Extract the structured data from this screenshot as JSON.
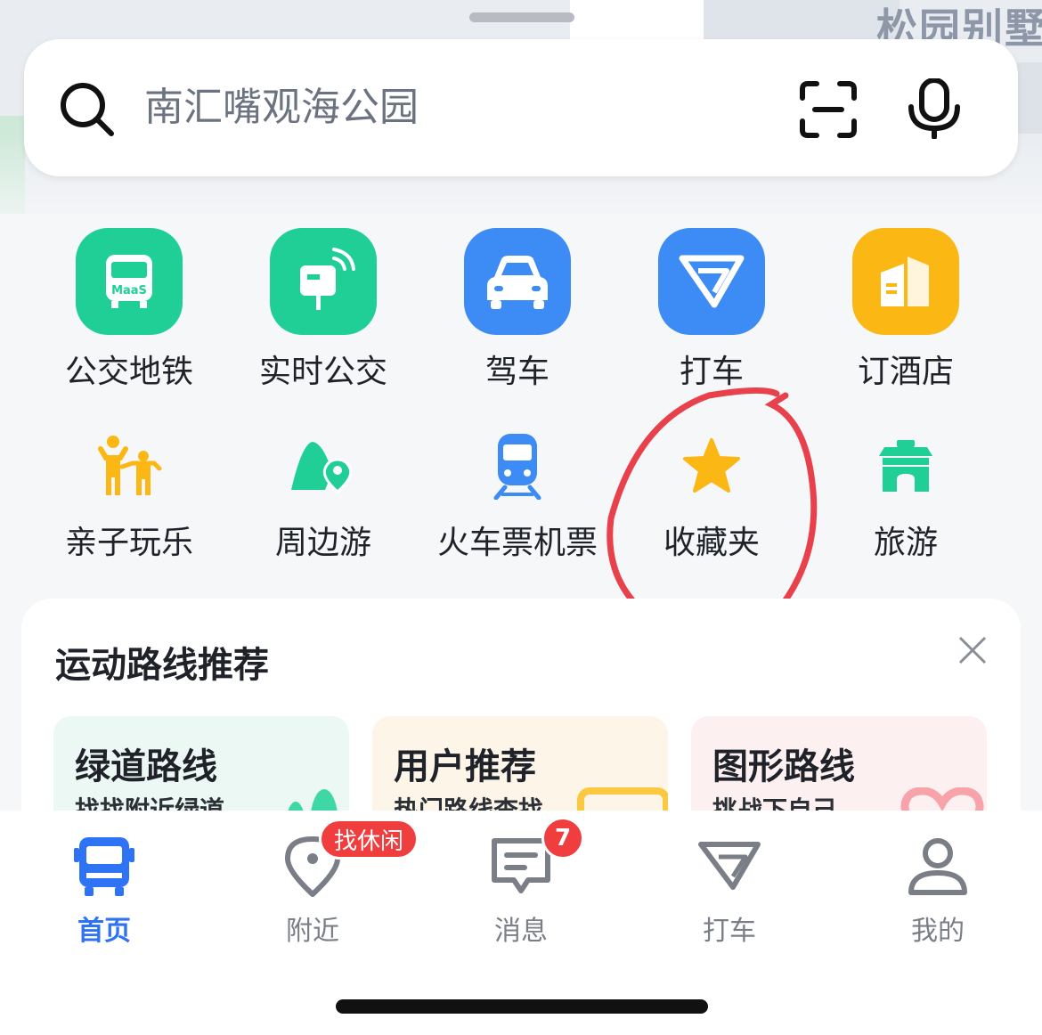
{
  "map": {
    "place_label": "松园别墅"
  },
  "search": {
    "placeholder": "南汇嘴观海公园"
  },
  "quick_actions": [
    {
      "label": "公交地铁",
      "icon": "bus-icon",
      "color": "#1fcf95"
    },
    {
      "label": "实时公交",
      "icon": "bus-stop-icon",
      "color": "#1fcf95"
    },
    {
      "label": "驾车",
      "icon": "car-icon",
      "color": "#3d8bf5"
    },
    {
      "label": "打车",
      "icon": "taxi-icon",
      "color": "#3d8bf5"
    },
    {
      "label": "订酒店",
      "icon": "hotel-icon",
      "color": "#fbb714"
    },
    {
      "label": "亲子玩乐",
      "icon": "family-icon",
      "color": "#fbb714"
    },
    {
      "label": "周边游",
      "icon": "mountain-pin-icon",
      "color": "#1fcf95"
    },
    {
      "label": "火车票机票",
      "icon": "train-icon",
      "color": "#3d8bf5"
    },
    {
      "label": "收藏夹",
      "icon": "star-icon",
      "color": "#fbb714"
    },
    {
      "label": "旅游",
      "icon": "gate-icon",
      "color": "#1fcf95"
    }
  ],
  "recommend": {
    "title": "运动路线推荐",
    "cards": [
      {
        "title": "绿道路线",
        "desc": "找找附近绿道"
      },
      {
        "title": "用户推荐",
        "desc": "热门路线查找"
      },
      {
        "title": "图形路线",
        "desc": "挑战下自己"
      }
    ]
  },
  "tabs": [
    {
      "label": "首页",
      "active": true
    },
    {
      "label": "附近",
      "badge": "找休闲"
    },
    {
      "label": "消息",
      "count": "7"
    },
    {
      "label": "打车"
    },
    {
      "label": "我的"
    }
  ],
  "colors": {
    "accent": "#2f73f5",
    "badge": "#f03e3e",
    "annotation": "#e8414b"
  }
}
